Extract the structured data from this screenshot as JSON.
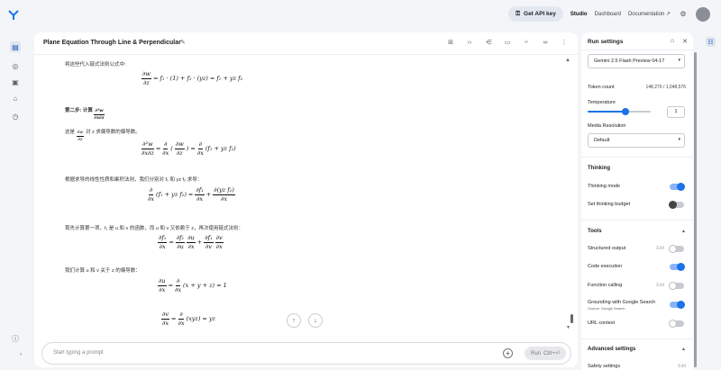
{
  "header": {
    "api_key_label": "Get API key",
    "studio_label": "Studio",
    "dashboard_label": "Dashboard",
    "documentation_label": "Documentation"
  },
  "prompt": {
    "title": "Plane Equation Through Line & Perpendicular",
    "placeholder": "Start typing a prompt",
    "run_label": "Run",
    "run_shortcut": "Ctrl+⏎"
  },
  "content": {
    "p1": "将这些代入链式法则公式中:",
    "step2": "第二步: 计算",
    "p2a": "这是",
    "p2b": "对 z 求偏导数的偏导数。",
    "p3": "根据求导的线性性质和乘积法则，我们分别对 f₁ 和 yz f₂ 求导：",
    "p4": "首先计算第一项，f₁ 是 u 和 v 的函数，而 u 和 v 又依赖于 z，再次使用链式法则：",
    "p5": "我们计算 u 和 v 关于 z 的偏导数："
  },
  "run_settings": {
    "title": "Run settings",
    "model": "Gemini 2.5 Flash Preview 04-17",
    "token_count_label": "Token count",
    "token_count_value": "148,270 / 1,048,576",
    "temperature_label": "Temperature",
    "temperature_value": "1",
    "media_resolution_label": "Media Resolution",
    "media_resolution_value": "Default",
    "thinking_title": "Thinking",
    "thinking_mode_label": "Thinking mode",
    "thinking_budget_label": "Set thinking budget",
    "tools_title": "Tools",
    "structured_output_label": "Structured output",
    "code_execution_label": "Code execution",
    "function_calling_label": "Function calling",
    "grounding_label": "Grounding with Google Search",
    "grounding_source": "Source: Google Search",
    "url_context_label": "URL context",
    "edit_label": "Edit",
    "advanced_title": "Advanced settings",
    "safety_label": "Safety settings"
  },
  "toggles": {
    "thinking_mode": true,
    "thinking_budget": false,
    "structured_output": false,
    "code_execution": true,
    "function_calling": false,
    "grounding": true,
    "url_context": false
  },
  "colors": {
    "accent": "#1a73e8"
  }
}
